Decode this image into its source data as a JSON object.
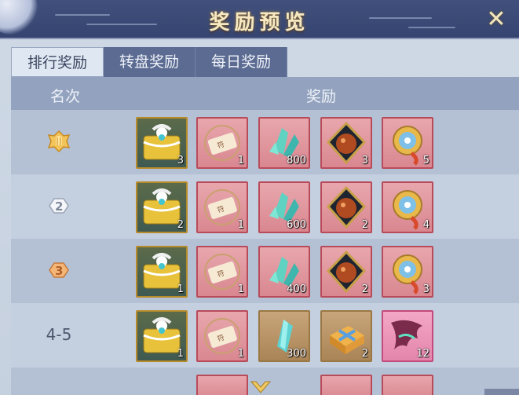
{
  "window": {
    "title": "奖励预览",
    "close_label": "✕"
  },
  "tabs": [
    {
      "label": "排行奖励",
      "active": true
    },
    {
      "label": "转盘奖励",
      "active": false
    },
    {
      "label": "每日奖励",
      "active": false
    }
  ],
  "table": {
    "col_rank": "名次",
    "col_reward": "奖励",
    "rows": [
      {
        "rank_icon": "rank-1-badge-icon",
        "rank_text": "",
        "quantities": [
          "3",
          "1",
          "800",
          "3",
          "5"
        ]
      },
      {
        "rank_icon": "rank-2-badge-icon",
        "rank_text": "",
        "quantities": [
          "2",
          "1",
          "600",
          "2",
          "4"
        ]
      },
      {
        "rank_icon": "rank-3-badge-icon",
        "rank_text": "",
        "quantities": [
          "1",
          "1",
          "400",
          "2",
          "3"
        ]
      },
      {
        "rank_icon": "",
        "rank_text": "4-5",
        "quantities": [
          "1",
          "1",
          "300",
          "2",
          "12"
        ]
      }
    ]
  },
  "colors": {
    "accent_gold": "#f6e9c2",
    "title_bar": "#3b4a76",
    "active_tab": "#dfe8f2"
  }
}
